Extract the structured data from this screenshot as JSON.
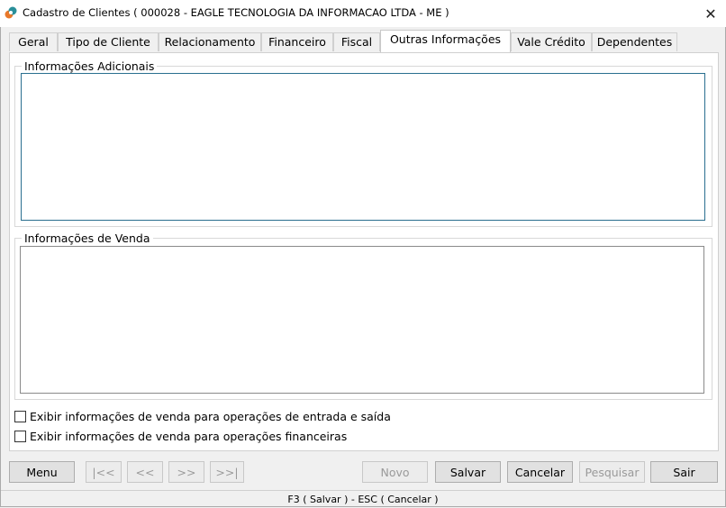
{
  "window": {
    "title": "Cadastro de Clientes ( 000028 - EAGLE TECNOLOGIA DA INFORMACAO LTDA - ME )",
    "close_glyph": "✕"
  },
  "tabs": [
    {
      "label": "Geral"
    },
    {
      "label": "Tipo de Cliente"
    },
    {
      "label": "Relacionamento"
    },
    {
      "label": "Financeiro"
    },
    {
      "label": "Fiscal"
    },
    {
      "label": "Outras Informações",
      "active": true
    },
    {
      "label": "Vale Crédito"
    },
    {
      "label": "Dependentes"
    }
  ],
  "groups": {
    "additional_info": {
      "legend": "Informações Adicionais",
      "value": ""
    },
    "sales_info": {
      "legend": "Informações de Venda",
      "value": ""
    }
  },
  "checkboxes": [
    {
      "label": "Exibir informações de venda para operações de entrada e saída",
      "checked": false
    },
    {
      "label": "Exibir informações de venda para operações financeiras",
      "checked": false
    }
  ],
  "buttons": {
    "menu": "Menu",
    "first": "|<<",
    "prev": "<<",
    "next": ">>",
    "last": ">>|",
    "new": "Novo",
    "save": "Salvar",
    "cancel": "Cancelar",
    "search": "Pesquisar",
    "exit": "Sair"
  },
  "status": "F3 ( Salvar )  -  ESC ( Cancelar )",
  "colors": {
    "icon_orange": "#e8782a",
    "icon_teal": "#2a8f9a",
    "focus_border": "#2a6f8f"
  }
}
